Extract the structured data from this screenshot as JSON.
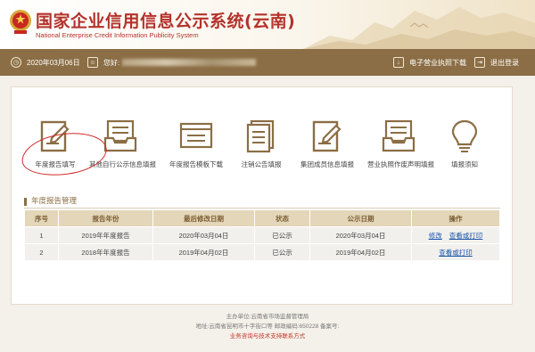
{
  "header": {
    "title_cn": "国家企业信用信息公示系统(云南)",
    "title_en": "National Enterprise Credit Information Publicity System"
  },
  "infobar": {
    "date": "2020年03月06日",
    "user_label": "您好:",
    "download": "电子营业执照下载",
    "logout": "退出登录"
  },
  "functions": [
    {
      "label": "年度报告填写",
      "icon": "edit-document-icon"
    },
    {
      "label": "其他自行公示信息填报",
      "icon": "inbox-tray-icon"
    },
    {
      "label": "年度报告模板下载",
      "icon": "window-list-icon"
    },
    {
      "label": "注销公告填报",
      "icon": "document-stack-icon"
    },
    {
      "label": "集团成员信息填报",
      "icon": "edit-document-icon"
    },
    {
      "label": "营业执照作废声明填报",
      "icon": "inbox-tray-icon"
    },
    {
      "label": "填报须知",
      "icon": "lightbulb-icon"
    }
  ],
  "report_section": {
    "title": "年度报告管理",
    "headers": [
      "序号",
      "报告年份",
      "最后修改日期",
      "状态",
      "公示日期",
      "操作"
    ],
    "rows": [
      {
        "no": "1",
        "year": "2019年年度报告",
        "modified": "2020年03月04日",
        "status": "已公示",
        "published": "2020年03月04日",
        "actions": [
          "修改",
          "查看或打印"
        ]
      },
      {
        "no": "2",
        "year": "2018年年度报告",
        "modified": "2019年04月02日",
        "status": "已公示",
        "published": "2019年04月02日",
        "actions": [
          "查看或打印"
        ]
      }
    ]
  },
  "footer": {
    "line1": "主办单位:云南省市场监督管理局",
    "line2": "地址:云南省昆明市十字街口等 邮政编码:650228 备案号:",
    "line3": "业务咨询与技术支持联系方式"
  },
  "colors": {
    "accent_red": "#b3322a",
    "bar_brown": "#8b6e45",
    "link_blue": "#1a56a8"
  }
}
